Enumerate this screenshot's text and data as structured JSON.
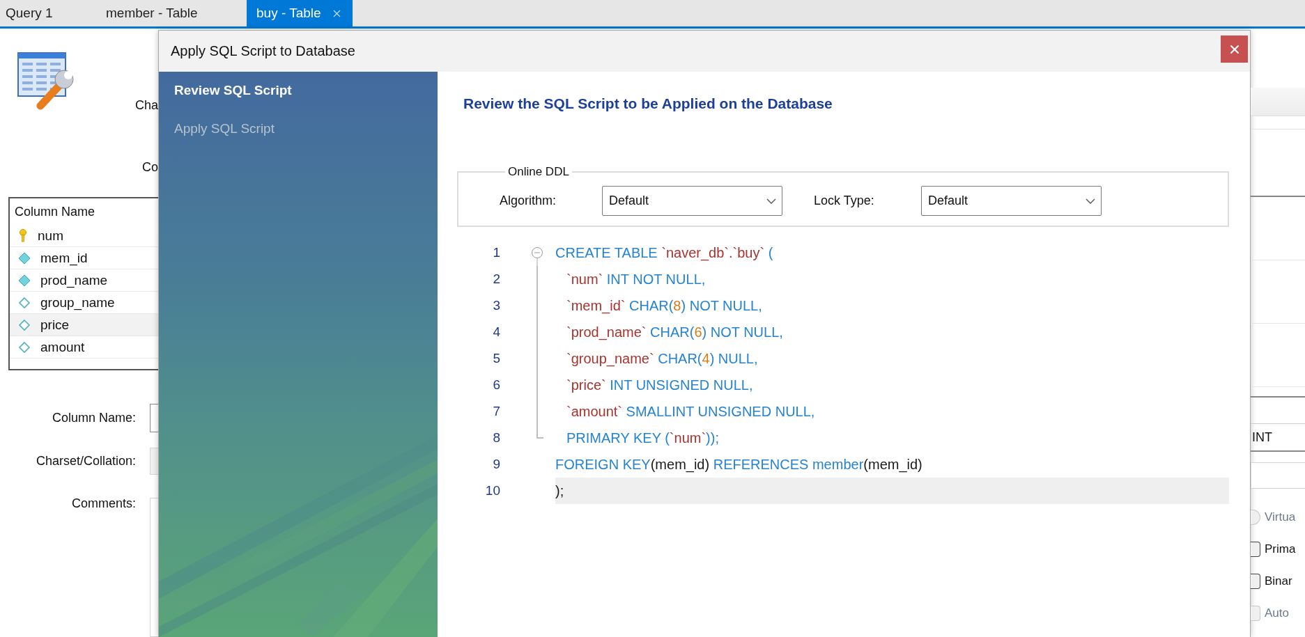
{
  "tabs": [
    {
      "label": "Query 1",
      "selected": false,
      "closable": false
    },
    {
      "label": "member - Table",
      "selected": false,
      "closable": false
    },
    {
      "label": "buy - Table",
      "selected": true,
      "closable": true
    }
  ],
  "editor": {
    "top_labels": [
      "Cha",
      "Co"
    ],
    "columns_header": "Column Name",
    "columns": [
      {
        "name": "num",
        "kind": "primary",
        "selected": false
      },
      {
        "name": "mem_id",
        "kind": "filled",
        "selected": false
      },
      {
        "name": "prod_name",
        "kind": "filled",
        "selected": false
      },
      {
        "name": "group_name",
        "kind": "hollow",
        "selected": false
      },
      {
        "name": "price",
        "kind": "hollow",
        "selected": true
      },
      {
        "name": "amount",
        "kind": "hollow",
        "selected": false
      }
    ],
    "detail_labels": [
      "Column Name:",
      "Charset/Collation:",
      "Comments:"
    ],
    "type_value": "INT",
    "options": [
      {
        "kind": "radio",
        "label": "Virtua",
        "checked": false,
        "disabled": true
      },
      {
        "kind": "checkbox",
        "label": "Prima",
        "checked": false,
        "disabled": false
      },
      {
        "kind": "checkbox",
        "label": "Binar",
        "checked": false,
        "disabled": false
      },
      {
        "kind": "checkbox",
        "label": "Auto",
        "checked": false,
        "disabled": true
      }
    ]
  },
  "dialog": {
    "title": "Apply SQL Script to Database",
    "steps": [
      {
        "label": "Review SQL Script",
        "selected": true
      },
      {
        "label": "Apply SQL Script",
        "selected": false
      }
    ],
    "heading": "Review the SQL Script to be Applied on the Database",
    "online_ddl": {
      "legend": "Online DDL",
      "fields": [
        {
          "label": "Algorithm:",
          "value": "Default"
        },
        {
          "label": "Lock Type:",
          "value": "Default"
        }
      ]
    },
    "code": [
      {
        "number": "1",
        "kind": "start",
        "current": false,
        "tokens": [
          {
            "kind": "keyword",
            "text": "CREATE TABLE "
          },
          {
            "kind": "name",
            "text": "`naver_db`.`buy`"
          },
          {
            "kind": "keyword",
            "text": " ("
          }
        ]
      },
      {
        "number": "2",
        "kind": "body",
        "current": false,
        "tokens": [
          {
            "kind": "name",
            "text": "`num`"
          },
          {
            "kind": "keyword",
            "text": " INT NOT NULL,"
          }
        ]
      },
      {
        "number": "3",
        "kind": "body",
        "current": false,
        "tokens": [
          {
            "kind": "name",
            "text": "`mem_id`"
          },
          {
            "kind": "keyword",
            "text": " CHAR("
          },
          {
            "kind": "number",
            "text": "8"
          },
          {
            "kind": "keyword",
            "text": ") NOT NULL,"
          }
        ]
      },
      {
        "number": "4",
        "kind": "body",
        "current": false,
        "tokens": [
          {
            "kind": "name",
            "text": "`prod_name`"
          },
          {
            "kind": "keyword",
            "text": " CHAR("
          },
          {
            "kind": "number",
            "text": "6"
          },
          {
            "kind": "keyword",
            "text": ") NOT NULL,"
          }
        ]
      },
      {
        "number": "5",
        "kind": "body",
        "current": false,
        "tokens": [
          {
            "kind": "name",
            "text": "`group_name`"
          },
          {
            "kind": "keyword",
            "text": " CHAR("
          },
          {
            "kind": "number",
            "text": "4"
          },
          {
            "kind": "keyword",
            "text": ") NULL,"
          }
        ]
      },
      {
        "number": "6",
        "kind": "body",
        "current": false,
        "tokens": [
          {
            "kind": "name",
            "text": "`price`"
          },
          {
            "kind": "keyword",
            "text": " INT UNSIGNED NULL,"
          }
        ]
      },
      {
        "number": "7",
        "kind": "body",
        "current": false,
        "tokens": [
          {
            "kind": "name",
            "text": "`amount`"
          },
          {
            "kind": "keyword",
            "text": " SMALLINT UNSIGNED NULL,"
          }
        ]
      },
      {
        "number": "8",
        "kind": "end",
        "current": false,
        "tokens": [
          {
            "kind": "keyword",
            "text": "PRIMARY KEY ("
          },
          {
            "kind": "name",
            "text": "`num`"
          },
          {
            "kind": "keyword",
            "text": "));"
          }
        ]
      },
      {
        "number": "9",
        "kind": "plain",
        "current": false,
        "tokens": [
          {
            "kind": "keyword",
            "text": "FOREIGN KEY"
          },
          {
            "kind": "plain",
            "text": "(mem_id)"
          },
          {
            "kind": "keyword",
            "text": " REFERENCES member"
          },
          {
            "kind": "plain",
            "text": "(mem_id)"
          }
        ]
      },
      {
        "number": "10",
        "kind": "plain",
        "current": true,
        "tokens": [
          {
            "kind": "plain",
            "text": ");"
          }
        ]
      }
    ]
  }
}
